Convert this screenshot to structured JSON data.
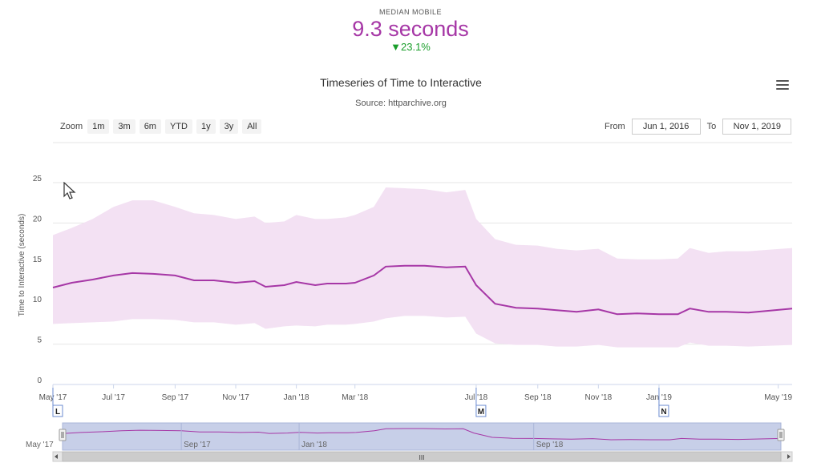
{
  "kpi": {
    "label": "MEDIAN MOBILE",
    "value": "9.3 seconds",
    "delta": "▼23.1%"
  },
  "chart_title": "Timeseries of Time to Interactive",
  "chart_subtitle": "Source: httparchive.org",
  "range_selector": {
    "zoom_label": "Zoom",
    "buttons": [
      "1m",
      "3m",
      "6m",
      "YTD",
      "1y",
      "3y",
      "All"
    ],
    "from_label": "From",
    "from_value": "Jun 1, 2016",
    "to_label": "To",
    "to_value": "Nov 1, 2019"
  },
  "chart_data": {
    "type": "line",
    "title": "Timeseries of Time to Interactive",
    "subtitle": "Source: httparchive.org",
    "ylabel": "Time to Interactive (seconds)",
    "xlabel": "",
    "ylim": [
      0,
      25
    ],
    "yticks": [
      0,
      5,
      10,
      15,
      20,
      25
    ],
    "xlim": [
      "2017-05-01",
      "2019-05-15"
    ],
    "xticks": [
      {
        "date": "2017-05-01",
        "label": "May '17"
      },
      {
        "date": "2017-07-01",
        "label": "Jul '17"
      },
      {
        "date": "2017-09-01",
        "label": "Sep '17"
      },
      {
        "date": "2017-11-01",
        "label": "Nov '17"
      },
      {
        "date": "2018-01-01",
        "label": "Jan '18"
      },
      {
        "date": "2018-03-01",
        "label": "Mar '18"
      },
      {
        "date": "2018-07-01",
        "label": "Jul '18"
      },
      {
        "date": "2018-09-01",
        "label": "Sep '18"
      },
      {
        "date": "2018-11-01",
        "label": "Nov '18"
      },
      {
        "date": "2019-01-01",
        "label": "Jan '19"
      },
      {
        "date": "2019-05-01",
        "label": "May '19"
      }
    ],
    "grid": true,
    "legend": "none",
    "series": [
      {
        "color": "#a637a6",
        "points": [
          [
            "2017-05-01",
            12.0
          ],
          [
            "2017-05-20",
            12.6
          ],
          [
            "2017-06-10",
            13.0
          ],
          [
            "2017-07-01",
            13.5
          ],
          [
            "2017-07-20",
            13.8
          ],
          [
            "2017-08-10",
            13.7
          ],
          [
            "2017-09-01",
            13.5
          ],
          [
            "2017-09-20",
            12.9
          ],
          [
            "2017-10-10",
            12.9
          ],
          [
            "2017-11-01",
            12.6
          ],
          [
            "2017-11-20",
            12.8
          ],
          [
            "2017-12-01",
            12.1
          ],
          [
            "2017-12-20",
            12.3
          ],
          [
            "2018-01-01",
            12.7
          ],
          [
            "2018-01-20",
            12.3
          ],
          [
            "2018-02-01",
            12.5
          ],
          [
            "2018-02-20",
            12.5
          ],
          [
            "2018-03-01",
            12.6
          ],
          [
            "2018-03-20",
            13.5
          ],
          [
            "2018-04-01",
            14.6
          ],
          [
            "2018-04-20",
            14.7
          ],
          [
            "2018-05-10",
            14.7
          ],
          [
            "2018-06-01",
            14.5
          ],
          [
            "2018-06-20",
            14.6
          ],
          [
            "2018-07-01",
            12.3
          ],
          [
            "2018-07-20",
            10.0
          ],
          [
            "2018-08-10",
            9.5
          ],
          [
            "2018-09-01",
            9.4
          ],
          [
            "2018-09-20",
            9.2
          ],
          [
            "2018-10-10",
            9.0
          ],
          [
            "2018-11-01",
            9.3
          ],
          [
            "2018-11-20",
            8.7
          ],
          [
            "2018-12-10",
            8.8
          ],
          [
            "2019-01-01",
            8.7
          ],
          [
            "2019-01-20",
            8.7
          ],
          [
            "2019-02-01",
            9.4
          ],
          [
            "2019-02-20",
            9.0
          ],
          [
            "2019-03-10",
            9.0
          ],
          [
            "2019-04-01",
            8.9
          ],
          [
            "2019-05-15",
            9.4
          ]
        ]
      }
    ],
    "band": {
      "color": "#f3e1f3",
      "upper": [
        [
          "2017-05-01",
          18.5
        ],
        [
          "2017-05-20",
          19.4
        ],
        [
          "2017-06-10",
          20.5
        ],
        [
          "2017-07-01",
          22.0
        ],
        [
          "2017-07-20",
          22.8
        ],
        [
          "2017-08-10",
          22.8
        ],
        [
          "2017-09-01",
          22.0
        ],
        [
          "2017-09-20",
          21.2
        ],
        [
          "2017-10-10",
          21.0
        ],
        [
          "2017-11-01",
          20.5
        ],
        [
          "2017-11-20",
          20.8
        ],
        [
          "2017-12-01",
          20.0
        ],
        [
          "2017-12-20",
          20.2
        ],
        [
          "2018-01-01",
          21.0
        ],
        [
          "2018-01-20",
          20.5
        ],
        [
          "2018-02-01",
          20.5
        ],
        [
          "2018-02-20",
          20.7
        ],
        [
          "2018-03-01",
          21.0
        ],
        [
          "2018-03-20",
          22.0
        ],
        [
          "2018-04-01",
          24.4
        ],
        [
          "2018-04-20",
          24.3
        ],
        [
          "2018-05-10",
          24.2
        ],
        [
          "2018-06-01",
          23.8
        ],
        [
          "2018-06-20",
          24.1
        ],
        [
          "2018-07-01",
          20.5
        ],
        [
          "2018-07-20",
          18.0
        ],
        [
          "2018-08-10",
          17.3
        ],
        [
          "2018-09-01",
          17.2
        ],
        [
          "2018-09-20",
          16.8
        ],
        [
          "2018-10-10",
          16.6
        ],
        [
          "2018-11-01",
          16.8
        ],
        [
          "2018-11-20",
          15.6
        ],
        [
          "2018-12-10",
          15.5
        ],
        [
          "2019-01-01",
          15.5
        ],
        [
          "2019-01-20",
          15.6
        ],
        [
          "2019-02-01",
          16.9
        ],
        [
          "2019-02-20",
          16.3
        ],
        [
          "2019-03-10",
          16.5
        ],
        [
          "2019-04-01",
          16.5
        ],
        [
          "2019-05-15",
          16.9
        ]
      ],
      "lower": [
        [
          "2017-05-01",
          7.5
        ],
        [
          "2017-05-20",
          7.6
        ],
        [
          "2017-06-10",
          7.7
        ],
        [
          "2017-07-01",
          7.8
        ],
        [
          "2017-07-20",
          8.1
        ],
        [
          "2017-08-10",
          8.1
        ],
        [
          "2017-09-01",
          8.0
        ],
        [
          "2017-09-20",
          7.7
        ],
        [
          "2017-10-10",
          7.7
        ],
        [
          "2017-11-01",
          7.4
        ],
        [
          "2017-11-20",
          7.6
        ],
        [
          "2017-12-01",
          6.9
        ],
        [
          "2017-12-20",
          7.2
        ],
        [
          "2018-01-01",
          7.3
        ],
        [
          "2018-01-20",
          7.2
        ],
        [
          "2018-02-01",
          7.4
        ],
        [
          "2018-02-20",
          7.4
        ],
        [
          "2018-03-01",
          7.5
        ],
        [
          "2018-03-20",
          7.8
        ],
        [
          "2018-04-01",
          8.2
        ],
        [
          "2018-04-20",
          8.5
        ],
        [
          "2018-05-10",
          8.5
        ],
        [
          "2018-06-01",
          8.3
        ],
        [
          "2018-06-20",
          8.4
        ],
        [
          "2018-07-01",
          6.3
        ],
        [
          "2018-07-20",
          5.1
        ],
        [
          "2018-08-10",
          4.9
        ],
        [
          "2018-09-01",
          4.9
        ],
        [
          "2018-09-20",
          4.7
        ],
        [
          "2018-10-10",
          4.7
        ],
        [
          "2018-11-01",
          4.9
        ],
        [
          "2018-11-20",
          4.6
        ],
        [
          "2018-12-10",
          4.6
        ],
        [
          "2019-01-01",
          4.6
        ],
        [
          "2019-01-20",
          4.6
        ],
        [
          "2019-02-01",
          5.2
        ],
        [
          "2019-02-20",
          4.8
        ],
        [
          "2019-03-10",
          4.8
        ],
        [
          "2019-04-01",
          4.7
        ],
        [
          "2019-05-15",
          4.9
        ]
      ]
    },
    "flags": [
      {
        "date": "2017-05-01",
        "label": "L"
      },
      {
        "date": "2018-07-01",
        "label": "M"
      },
      {
        "date": "2019-01-01",
        "label": "N"
      }
    ],
    "navigator": {
      "xticks": [
        {
          "date": "2017-05-01",
          "label": "May '17"
        },
        {
          "date": "2017-09-01",
          "label": "Sep '17"
        },
        {
          "date": "2018-01-01",
          "label": "Jan '18"
        },
        {
          "date": "2018-09-01",
          "label": "Sep '18"
        }
      ]
    },
    "scrollbar_grip": "III"
  }
}
